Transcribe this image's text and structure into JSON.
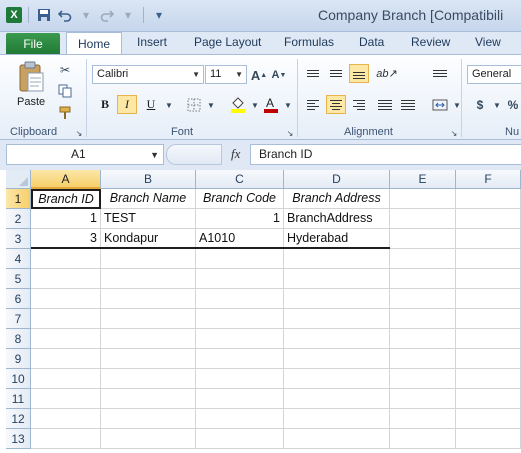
{
  "window": {
    "title": "Company Branch  [Compatibili",
    "qat": {
      "app_icon": "X",
      "save_icon": "save-icon",
      "undo_icon": "undo-icon",
      "redo_icon": "redo-icon",
      "customize_icon": "customize-qat-icon"
    }
  },
  "tabs": [
    "File",
    "Home",
    "Insert",
    "Page Layout",
    "Formulas",
    "Data",
    "Review",
    "View"
  ],
  "ribbon": {
    "clipboard": {
      "paste_label": "Paste",
      "group_label": "Clipboard"
    },
    "font": {
      "font_name": "Calibri",
      "font_size": "11",
      "bold": "B",
      "italic": "I",
      "underline": "U",
      "group_label": "Font",
      "font_color": "#c00000",
      "fill_color": "#ffff00"
    },
    "alignment": {
      "group_label": "Alignment"
    },
    "number": {
      "format": "General",
      "currency": "$",
      "percent": "%",
      "group_label": "Nu"
    }
  },
  "formula_bar": {
    "name_box": "A1",
    "fx": "fx",
    "formula": "Branch ID"
  },
  "grid": {
    "columns": [
      "A",
      "B",
      "C",
      "D",
      "E",
      "F"
    ],
    "rows": [
      "1",
      "2",
      "3",
      "4",
      "5",
      "6",
      "7",
      "8",
      "9",
      "10",
      "11",
      "12",
      "13"
    ],
    "cells": {
      "A1": "Branch ID",
      "B1": "Branch Name",
      "C1": "Branch Code",
      "D1": "Branch Address",
      "A2": "1",
      "B2": "TEST",
      "C2": "1",
      "D2": "BranchAddress",
      "A3": "3",
      "B3": "Kondapur",
      "C3": "A1010",
      "D3": "Hyderabad"
    }
  }
}
